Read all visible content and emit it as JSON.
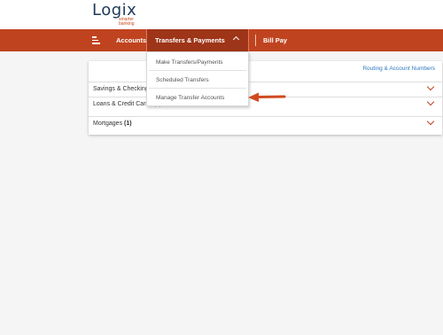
{
  "logo": {
    "name": "Logix",
    "tagline": "smarter banking"
  },
  "nav": {
    "menu_icon": "hamburger-icon",
    "accounts": "Accounts",
    "transfers_payments": "Transfers & Payments",
    "transfers_chevron": "chevron-up-icon",
    "bill_pay": "Bill Pay"
  },
  "dropdown": {
    "items": [
      "Make Transfers/Payments",
      "Scheduled Transfers",
      "Manage Transfer Accounts"
    ]
  },
  "accounts_panel": {
    "routing_link": "Routing & Account Numbers",
    "rows": [
      {
        "label": "Savings & Checking",
        "count": ""
      },
      {
        "label": "Loans & Credit Cards (3)",
        "count": ""
      },
      {
        "label": "Mortgages",
        "count": "(1)"
      }
    ]
  },
  "annotation": {
    "type": "arrow-icon",
    "points_to": "Manage Transfer Accounts",
    "color": "#d04a1f"
  },
  "colors": {
    "brand_orange": "#c0431f",
    "brand_navy": "#1f3a5a",
    "link_blue": "#2b78c0"
  }
}
